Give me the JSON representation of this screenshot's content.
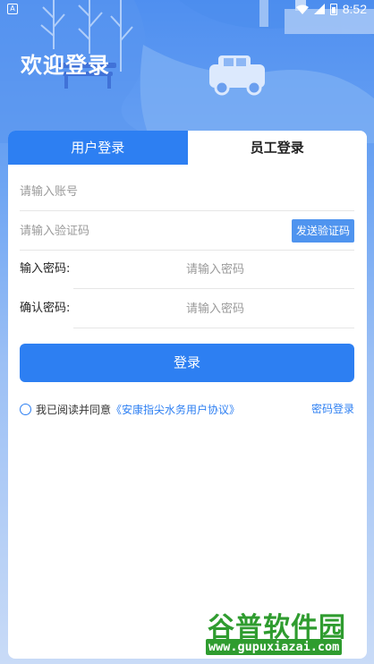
{
  "status_bar": {
    "time": "8:52",
    "left_icon": "notification-icon",
    "right_icons": [
      "wifi-icon",
      "signal-icon",
      "battery-icon"
    ]
  },
  "header": {
    "title": "欢迎登录"
  },
  "tabs": [
    {
      "label": "用户登录",
      "active": true
    },
    {
      "label": "员工登录",
      "active": false
    }
  ],
  "form": {
    "account": {
      "placeholder": "请输入账号",
      "value": ""
    },
    "code": {
      "placeholder": "请输入验证码",
      "value": "",
      "send_button": "发送验证码"
    },
    "password": {
      "label": "输入密码:",
      "placeholder": "请输入密码",
      "value": ""
    },
    "confirm_password": {
      "label": "确认密码:",
      "placeholder": "请输入密码",
      "value": ""
    }
  },
  "login_button": "登录",
  "agreement": {
    "prefix": "我已阅读并同意",
    "link": "《安康指尖水务用户协议》",
    "checked": false
  },
  "password_login": "密码登录",
  "watermark": {
    "title": "谷普软件园",
    "url": "www.gupuxiazai.com"
  },
  "colors": {
    "primary": "#2d7ff2",
    "send_button": "#4f94ef",
    "watermark_green": "#2f9c2f"
  }
}
